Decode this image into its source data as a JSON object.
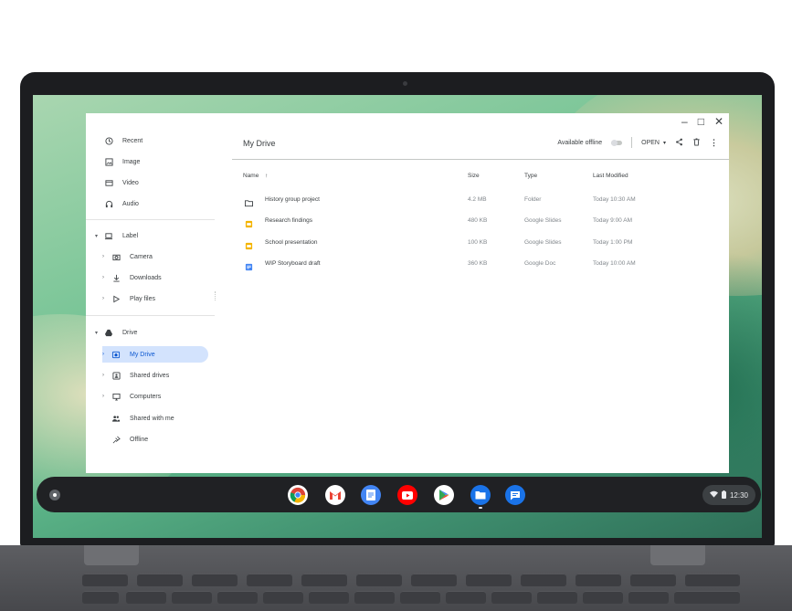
{
  "window": {
    "controls": {
      "minimize": "–",
      "maximize": "□",
      "close": "✕"
    }
  },
  "sidebar": {
    "items": [
      {
        "label": "Recent",
        "icon": "clock-icon"
      },
      {
        "label": "Image",
        "icon": "image-icon"
      },
      {
        "label": "Video",
        "icon": "video-icon"
      },
      {
        "label": "Audio",
        "icon": "headphones-icon"
      },
      {
        "label": "Label",
        "icon": "laptop-icon"
      },
      {
        "label": "Camera",
        "icon": "camera-icon"
      },
      {
        "label": "Downloads",
        "icon": "download-icon"
      },
      {
        "label": "Play files",
        "icon": "play-icon"
      },
      {
        "label": "Drive",
        "icon": "drive-icon"
      },
      {
        "label": "My Drive",
        "icon": "my-drive-icon"
      },
      {
        "label": "Shared drives",
        "icon": "shared-drive-icon"
      },
      {
        "label": "Computers",
        "icon": "computer-icon"
      },
      {
        "label": "Shared with me",
        "icon": "people-icon"
      },
      {
        "label": "Offline",
        "icon": "pin-icon"
      }
    ]
  },
  "main": {
    "title": "My Drive",
    "available_offline": "Available offline",
    "open_label": "OPEN",
    "open_caret": "▾",
    "columns": {
      "name": "Name",
      "sort_arrow": "↑",
      "size": "Size",
      "type": "Type",
      "modified": "Last Modified"
    },
    "files": [
      {
        "name": "History group project",
        "size": "4.2 MB",
        "type": "Folder",
        "modified": "Today 10:30 AM",
        "icon": "folder-icon"
      },
      {
        "name": "Research findings",
        "size": "480 KB",
        "type": "Google Slides",
        "modified": "Today 9:00 AM",
        "icon": "slides-icon"
      },
      {
        "name": "School presentation",
        "size": "100 KB",
        "type": "Google Slides",
        "modified": "Today 1:00 PM",
        "icon": "slides-icon"
      },
      {
        "name": "WIP Storyboard draft",
        "size": "360 KB",
        "type": "Google Doc",
        "modified": "Today 10:00 AM",
        "icon": "docs-icon"
      }
    ]
  },
  "shelf": {
    "apps": [
      "Chrome",
      "Gmail",
      "Docs",
      "YouTube",
      "Play Store",
      "Files",
      "Messages"
    ],
    "time": "12:30"
  },
  "colors": {
    "accent": "#0b57d0",
    "active_bg": "#d3e3fd",
    "slides": "#f4b400",
    "docs": "#4285f4"
  }
}
